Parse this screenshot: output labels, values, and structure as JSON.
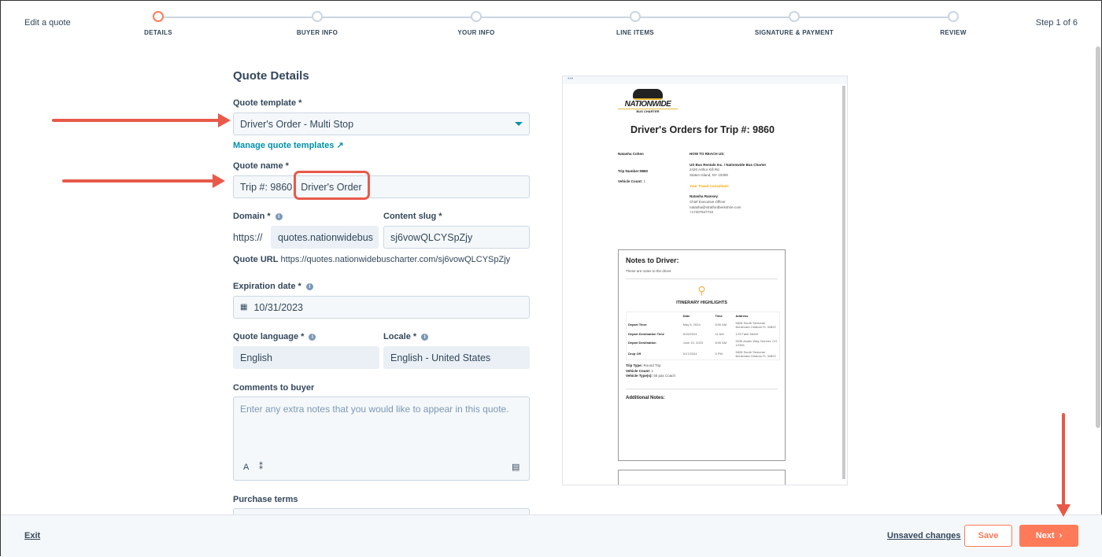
{
  "header": {
    "title": "Edit a quote",
    "step_count": "Step 1 of 6",
    "steps": [
      {
        "label": "DETAILS"
      },
      {
        "label": "BUYER INFO"
      },
      {
        "label": "YOUR INFO"
      },
      {
        "label": "LINE ITEMS"
      },
      {
        "label": "SIGNATURE & PAYMENT"
      },
      {
        "label": "REVIEW"
      }
    ]
  },
  "form": {
    "heading": "Quote Details",
    "template_label": "Quote template *",
    "template_value": "Driver's Order - Multi Stop",
    "manage_link": "Manage quote templates",
    "name_label": "Quote name *",
    "name_prefix": "Trip #: 9860",
    "name_highlight": "Driver's Order",
    "domain_label": "Domain *",
    "domain_prefix": "https://",
    "domain_value": "quotes.nationwidebus",
    "slug_label": "Content slug *",
    "slug_value": "sj6vowQLCYSpZjy",
    "url_label": "Quote URL",
    "url_value": "https://quotes.nationwidebuscharter.com/sj6vowQLCYSpZjy",
    "exp_label": "Expiration date *",
    "exp_value": "10/31/2023",
    "lang_label": "Quote language *",
    "lang_value": "English",
    "locale_label": "Locale *",
    "locale_value": "English - United States",
    "comments_label": "Comments to buyer",
    "comments_placeholder": "Enter any extra notes that you would like to appear in this quote.",
    "terms_label": "Purchase terms"
  },
  "preview": {
    "logo_text": "NATIONWIDE",
    "logo_sub": "BUS CHARTER",
    "title": "Driver's Orders for Trip #: 9860",
    "customer": "Natasha Cohen",
    "trip_number": "Trip Number:9860",
    "vehicle_count_label": "Vehicle Count:",
    "vehicle_count": "1",
    "reach_heading": "HOW TO REACH US:",
    "company": "US Bus Rentals Inc. / Nationwide Bus Charter",
    "addr1": "2420 Arthur Kill Rd.",
    "addr2": "Staten Island, NY 10309",
    "consultant_heading": "Your Travel Consultant:",
    "consultant_name": "Natasha Ramsey",
    "consultant_title": "Chief Executive Officer",
    "consultant_email": "natasha@stratfordberkshire.com",
    "consultant_phone": "+17207847722",
    "notes_heading": "Notes to Driver:",
    "notes_text": "These are notes to the driver.",
    "itinerary_heading": "ITINERARY HIGHLIGHTS",
    "table_headers": [
      "",
      "Date",
      "Time",
      "Address"
    ],
    "rows": [
      [
        "Depart Time:",
        "May 5, 2024",
        "8:00 AM",
        "5828 South Semoran Boulevard Orlando FL 32822"
      ],
      [
        "Depart Destination Time",
        "5/15/2024",
        "11 AM",
        "123 Fake Street"
      ],
      [
        "Depart Destination",
        "June 10, 2023",
        "8:00 AM",
        "5236 Austin Way, Denver, CO 12345"
      ],
      [
        "Drop Off",
        "5/17/2024",
        "5 PM",
        "5828 South Semoran Boulevard Orlando FL 32822"
      ]
    ],
    "trip_type_label": "Trip Type:",
    "trip_type": "Round Trip",
    "vc_label": "Vehicle Count:",
    "vc": "1",
    "vt_label": "Vehicle Type(s):",
    "vt": "55 pax Coach",
    "additional_notes": "Additional Notes:"
  },
  "footer": {
    "exit": "Exit",
    "unsaved": "Unsaved changes",
    "save": "Save",
    "next": "Next"
  },
  "colors": {
    "accent": "#ff7a59",
    "link": "#0091ae",
    "annotation": "#e8594a"
  }
}
